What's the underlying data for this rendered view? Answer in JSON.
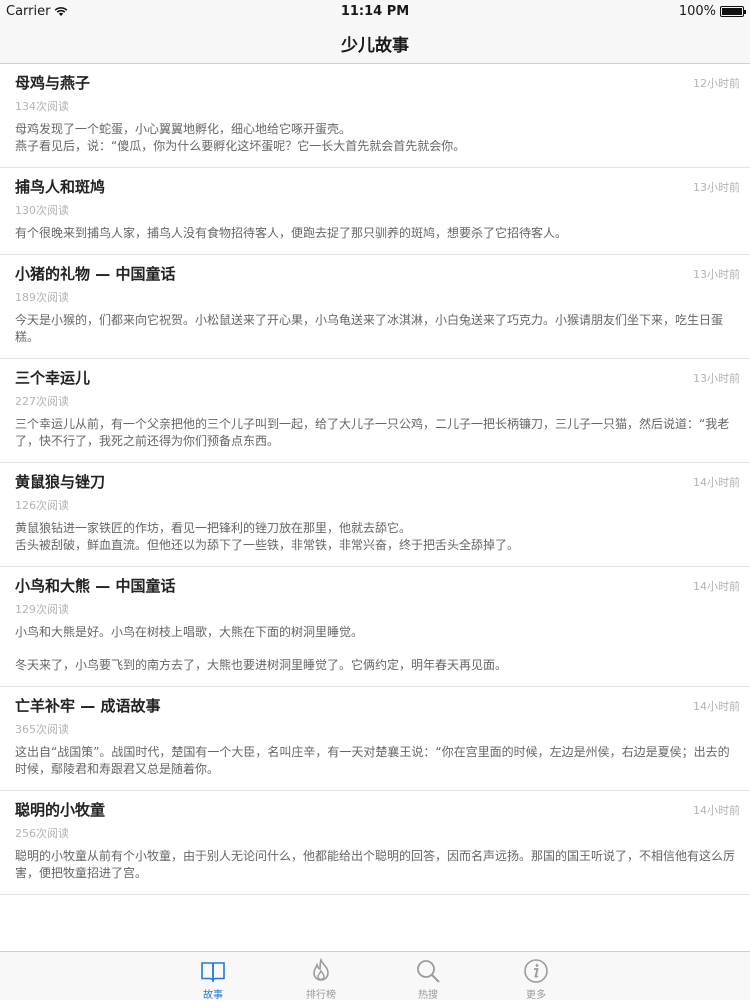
{
  "status_bar": {
    "carrier": "Carrier",
    "time": "11:14 PM",
    "battery": "100%"
  },
  "nav": {
    "title": "少儿故事"
  },
  "stories": [
    {
      "title": "母鸡与燕子",
      "time": "12小时前",
      "reads": "134次阅读",
      "summary": [
        "母鸡发现了一个蛇蛋，小心翼翼地孵化，细心地给它啄开蛋壳。",
        "燕子看见后，说：“傻瓜，你为什么要孵化这坏蛋呢？它一长大首先就会首先就会你。"
      ]
    },
    {
      "title": "捕鸟人和斑鸠",
      "time": "13小时前",
      "reads": "130次阅读",
      "summary": [
        "有个很晚来到捕鸟人家，捕鸟人没有食物招待客人，便跑去捉了那只驯养的斑鸠，想要杀了它招待客人。"
      ]
    },
    {
      "title": "小猪的礼物 — 中国童话",
      "time": "13小时前",
      "reads": "189次阅读",
      "summary": [
        "今天是小猴的，们都来向它祝贺。小松鼠送来了开心果，小乌龟送来了冰淇淋，小白兔送来了巧克力。小猴请朋友们坐下来，吃生日蛋糕。"
      ]
    },
    {
      "title": "三个幸运儿",
      "time": "13小时前",
      "reads": "227次阅读",
      "summary": [
        "三个幸运儿从前，有一个父亲把他的三个儿子叫到一起，给了大儿子一只公鸡，二儿子一把长柄镰刀，三儿子一只猫，然后说道：“我老了，快不行了，我死之前还得为你们预备点东西。"
      ]
    },
    {
      "title": "黄鼠狼与锉刀",
      "time": "14小时前",
      "reads": "126次阅读",
      "summary": [
        "黄鼠狼钻进一家铁匠的作坊，看见一把锋利的锉刀放在那里，他就去舔它。",
        "舌头被刮破，鲜血直流。但他还以为舔下了一些铁，非常铁，非常兴奋，终于把舌头全舔掉了。"
      ]
    },
    {
      "title": "小鸟和大熊 — 中国童话",
      "time": "14小时前",
      "reads": "129次阅读",
      "summary": [
        "小鸟和大熊是好。小鸟在树枝上唱歌，大熊在下面的树洞里睡觉。",
        "冬天来了，小鸟要飞到的南方去了，大熊也要进树洞里睡觉了。它俩约定，明年春天再见面。"
      ],
      "gap": true
    },
    {
      "title": "亡羊补牢 — 成语故事",
      "time": "14小时前",
      "reads": "365次阅读",
      "summary": [
        "这出自“战国策”。战国时代，楚国有一个大臣，名叫庄辛，有一天对楚襄王说：“你在宫里面的时候，左边是州侯，右边是夏侯；出去的时候，鄢陵君和寿跟君又总是随着你。"
      ]
    },
    {
      "title": "聪明的小牧童",
      "time": "14小时前",
      "reads": "256次阅读",
      "summary": [
        "聪明的小牧童从前有个小牧童，由于别人无论问什么，他都能给出个聪明的回答，因而名声远扬。那国的国王听说了，不相信他有这么厉害，便把牧童招进了宫。"
      ]
    }
  ],
  "tabs": [
    {
      "label": "故事",
      "icon": "book-icon",
      "active": true
    },
    {
      "label": "排行榜",
      "icon": "flame-icon",
      "active": false
    },
    {
      "label": "热搜",
      "icon": "search-icon",
      "active": false
    },
    {
      "label": "更多",
      "icon": "info-icon",
      "active": false
    }
  ],
  "colors": {
    "accent": "#1f7ae0",
    "inactive": "#9b9b9b",
    "muted": "#b3b3b3"
  }
}
